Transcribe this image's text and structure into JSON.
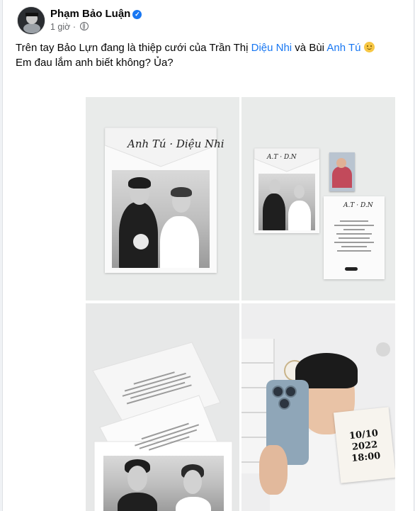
{
  "post": {
    "author": "Phạm Bảo Luận",
    "time": "1 giờ",
    "separator": "·",
    "text": {
      "part1": "Trên tay Bảo Lựn đang là thiệp cưới của Trần Thị ",
      "link1": "Diệu Nhi",
      "part2": " và Bùi ",
      "link2": "Anh Tú",
      "line2": "Em đau lắm anh biết không? Ủa?"
    },
    "colors": {
      "link": "#1877f2",
      "verified": "#1877f2"
    },
    "icons": {
      "verified": "verified-badge-icon",
      "audience": "globe-icon",
      "emoji": "smile-emoji-icon"
    }
  },
  "photos": {
    "card_script": "Anh Tú · Diệu Nhi",
    "date_line1": "10/10",
    "date_line2": "2022",
    "date_line3": "18:00"
  }
}
